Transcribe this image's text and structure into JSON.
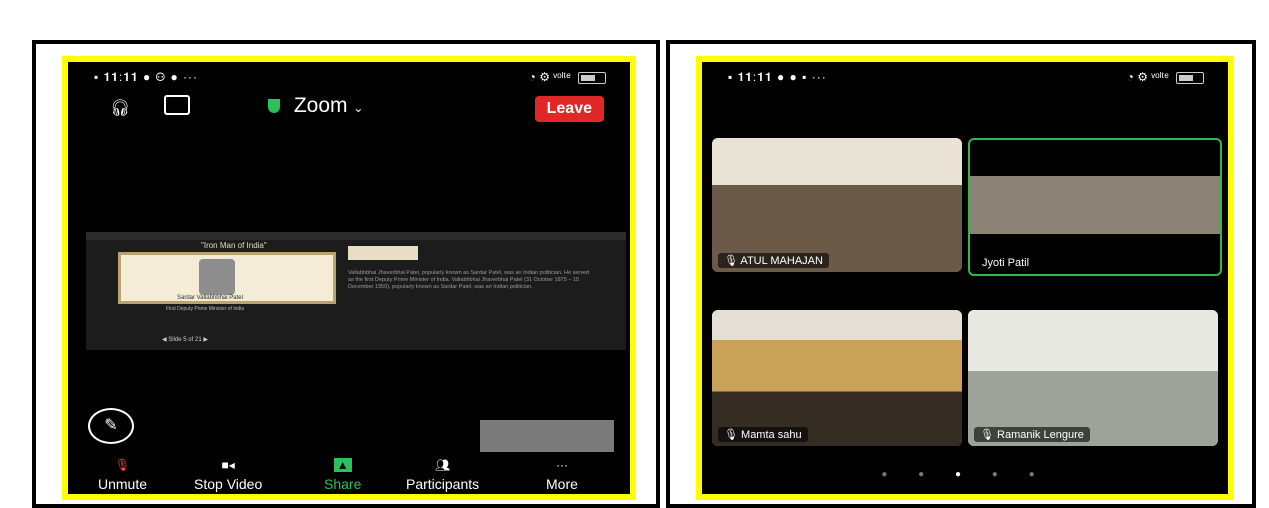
{
  "left_phone": {
    "status": {
      "left": "▪︎ 𝟏𝟏:𝟏𝟏 ● ⚇ ● ···",
      "right": "◔ ⚙ ᵛᵒˡᵗᵉ"
    },
    "app_title": "Zoom",
    "leave_label": "Leave",
    "slide": {
      "title": "\"Iron Man of India\"",
      "caption": "Sardar Vallabhbhai Patel",
      "subcaption": "First Deputy Prime Minister of India",
      "page_indicator": "Slide 5 of 21"
    },
    "slide_notes": "Vallabhbhai Jhaverbhai Patel, popularly known as Sardar Patel, was an Indian politician. He served as the first Deputy Prime Minister of India. Vallabhbhai Jhaverbhai Patel (31 October 1875 – 15 December 1950), popularly known as Sardar Patel, was an Indian politician.",
    "toolbar": [
      {
        "label": "Unmute",
        "icon": "microphone-muted-icon"
      },
      {
        "label": "Stop Video",
        "icon": "video-camera-icon"
      },
      {
        "label": "Share",
        "icon": "share-arrow-icon"
      },
      {
        "label": "Participants",
        "icon": "participants-icon"
      },
      {
        "label": "More",
        "icon": "more-dots-icon"
      }
    ],
    "accent_colors": {
      "leave": "#e02828",
      "share": "#2ac05a",
      "frame": "#ffff00"
    }
  },
  "right_phone": {
    "status": {
      "left": "▪︎ 𝟏𝟏:𝟏𝟏 ● ● ▪︎ ···",
      "right": "◔ ⚙ ᵛᵒˡᵗᵉ"
    },
    "participants": [
      {
        "name": "ATUL MAHAJAN",
        "muted": true
      },
      {
        "name": "Jyoti Patil",
        "muted": false,
        "active_speaker": true
      },
      {
        "name": "Mamta sahu",
        "muted": true
      },
      {
        "name": "Ramanik Lengure",
        "muted": true
      }
    ],
    "pager": {
      "pages": 5,
      "current": 3
    }
  }
}
